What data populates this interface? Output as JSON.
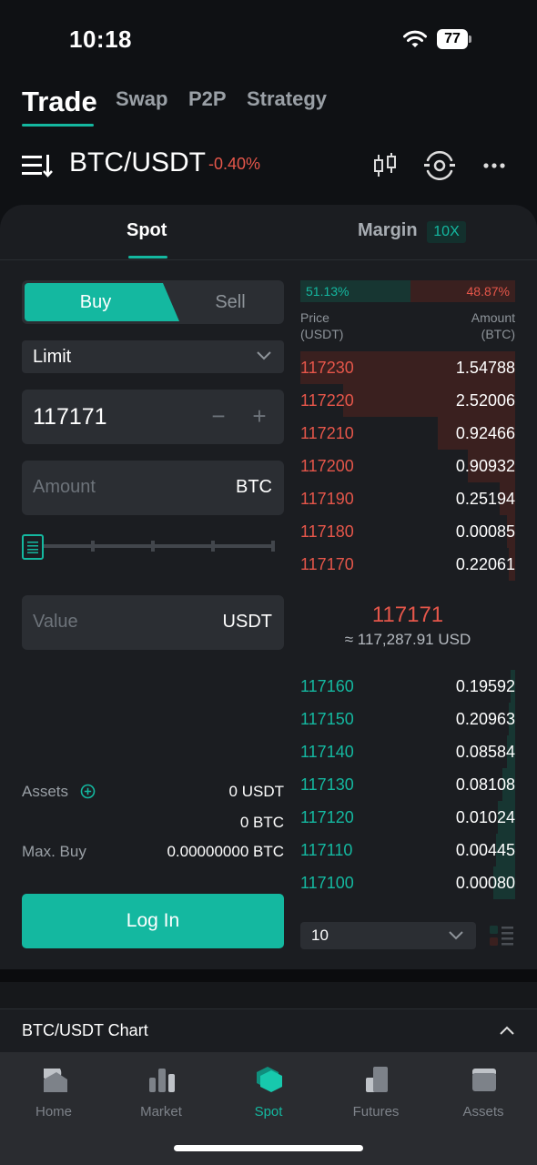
{
  "status": {
    "time": "10:18",
    "battery": "77"
  },
  "top_tabs": [
    {
      "label": "Trade",
      "active": true
    },
    {
      "label": "Swap"
    },
    {
      "label": "P2P"
    },
    {
      "label": "Strategy"
    }
  ],
  "pair": {
    "name": "BTC/USDT",
    "change": "-0.40%"
  },
  "mode_tabs": {
    "spot": "Spot",
    "margin": "Margin",
    "leverage": "10X"
  },
  "order_form": {
    "buy_label": "Buy",
    "sell_label": "Sell",
    "order_type": "Limit",
    "price_value": "117171",
    "stepper_minus": "−",
    "stepper_plus": "+",
    "amount_placeholder": "Amount",
    "amount_unit": "BTC",
    "value_placeholder": "Value",
    "value_unit": "USDT",
    "slider_percent": 0
  },
  "assets": {
    "label": "Assets",
    "usdt": "0 USDT",
    "btc": "0 BTC",
    "max_buy_label": "Max. Buy",
    "max_buy_value": "0.00000000 BTC"
  },
  "login_label": "Log In",
  "orderbook": {
    "buy_ratio": "51.13%",
    "sell_ratio": "48.87%",
    "price_header_1": "Price",
    "price_header_2": "(USDT)",
    "amount_header_1": "Amount",
    "amount_header_2": "(BTC)",
    "asks": [
      {
        "price": "117230",
        "amount": "1.54788",
        "depth": 1.0
      },
      {
        "price": "117220",
        "amount": "2.52006",
        "depth": 0.8
      },
      {
        "price": "117210",
        "amount": "0.92466",
        "depth": 0.36
      },
      {
        "price": "117200",
        "amount": "0.90932",
        "depth": 0.22
      },
      {
        "price": "117190",
        "amount": "0.25194",
        "depth": 0.07
      },
      {
        "price": "117180",
        "amount": "0.00085",
        "depth": 0.04
      },
      {
        "price": "117170",
        "amount": "0.22061",
        "depth": 0.03
      }
    ],
    "mid_price": "117171",
    "mid_usd": "≈ 117,287.91 USD",
    "bids": [
      {
        "price": "117160",
        "amount": "0.19592",
        "depth": 0.02
      },
      {
        "price": "117150",
        "amount": "0.20963",
        "depth": 0.03
      },
      {
        "price": "117140",
        "amount": "0.08584",
        "depth": 0.04
      },
      {
        "price": "117130",
        "amount": "0.08108",
        "depth": 0.06
      },
      {
        "price": "117120",
        "amount": "0.01024",
        "depth": 0.08
      },
      {
        "price": "117110",
        "amount": "0.00445",
        "depth": 0.09
      },
      {
        "price": "117100",
        "amount": "0.00080",
        "depth": 0.1
      }
    ],
    "depth_value": "10"
  },
  "chart_bar": {
    "title": "BTC/USDT Chart"
  },
  "bottom_nav": [
    {
      "label": "Home",
      "icon": "home-icon"
    },
    {
      "label": "Market",
      "icon": "market-icon"
    },
    {
      "label": "Spot",
      "icon": "spot-icon",
      "active": true
    },
    {
      "label": "Futures",
      "icon": "futures-icon"
    },
    {
      "label": "Assets",
      "icon": "wallet-icon"
    }
  ],
  "colors": {
    "accent": "#14b8a0",
    "sell": "#e5564a",
    "background": "#0f1114",
    "panel": "#1b1d21"
  }
}
